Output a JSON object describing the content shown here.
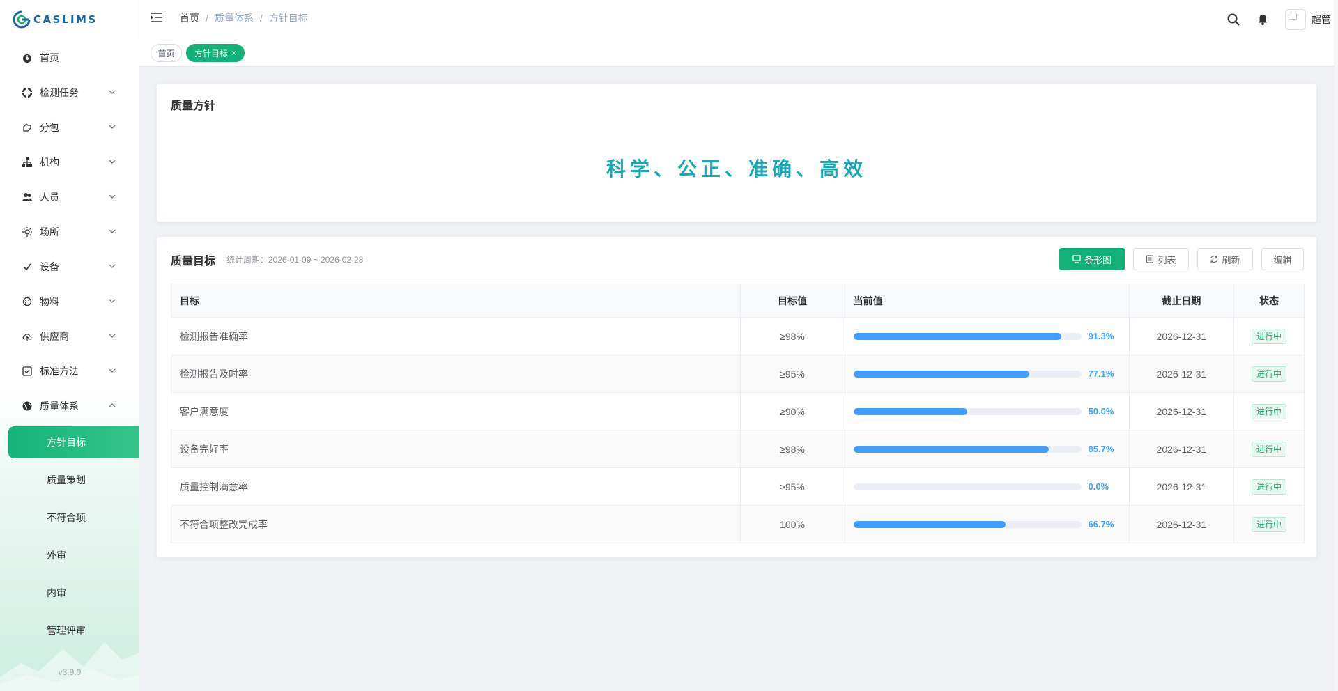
{
  "app": {
    "logo_text": "CASLIMS",
    "version": "v3.9.0"
  },
  "sidebar": {
    "items": [
      {
        "label": "首页",
        "icon": "dashboard-icon"
      },
      {
        "label": "检测任务",
        "icon": "task-icon"
      },
      {
        "label": "分包",
        "icon": "subcontract-icon"
      },
      {
        "label": "机构",
        "icon": "org-tree-icon"
      },
      {
        "label": "人员",
        "icon": "users-icon"
      },
      {
        "label": "场所",
        "icon": "sun-icon"
      },
      {
        "label": "设备",
        "icon": "check-icon"
      },
      {
        "label": "物料",
        "icon": "palette-icon"
      },
      {
        "label": "供应商",
        "icon": "cloud-upload-icon"
      },
      {
        "label": "标准方法",
        "icon": "checkbox-icon"
      },
      {
        "label": "质量体系",
        "icon": "globe-icon"
      }
    ],
    "sub_items": [
      {
        "label": "方针目标"
      },
      {
        "label": "质量策划"
      },
      {
        "label": "不符合项"
      },
      {
        "label": "外审"
      },
      {
        "label": "内审"
      },
      {
        "label": "管理评审"
      }
    ]
  },
  "header": {
    "breadcrumb": [
      "首页",
      "质量体系",
      "方针目标"
    ],
    "user_name": "超管"
  },
  "tags": {
    "home": "首页",
    "active": "方针目标",
    "close": "×"
  },
  "policy_card": {
    "title": "质量方针",
    "policy": "科学、公正、准确、高效"
  },
  "goals_card": {
    "title": "质量目标",
    "period": "统计周期：2026-01-09 ~ 2026-02-28",
    "buttons": {
      "chart": "条形图",
      "list": "列表",
      "refresh": "刷新",
      "edit": "编辑"
    },
    "columns": {
      "name": "目标",
      "target": "目标值",
      "current": "当前值",
      "deadline": "截止日期",
      "status": "状态"
    },
    "rows": [
      {
        "name": "检测报告准确率",
        "target": "≥98%",
        "progress": 91.3,
        "progress_text": "91.3%",
        "deadline": "2026-12-31",
        "status": "进行中"
      },
      {
        "name": "检测报告及时率",
        "target": "≥95%",
        "progress": 77.1,
        "progress_text": "77.1%",
        "deadline": "2026-12-31",
        "status": "进行中"
      },
      {
        "name": "客户满意度",
        "target": "≥90%",
        "progress": 50.0,
        "progress_text": "50.0%",
        "deadline": "2026-12-31",
        "status": "进行中"
      },
      {
        "name": "设备完好率",
        "target": "≥98%",
        "progress": 85.7,
        "progress_text": "85.7%",
        "deadline": "2026-12-31",
        "status": "进行中"
      },
      {
        "name": "质量控制满意率",
        "target": "≥95%",
        "progress": 0.0,
        "progress_text": "0.0%",
        "deadline": "2026-12-31",
        "status": "进行中"
      },
      {
        "name": "不符合项整改完成率",
        "target": "100%",
        "progress": 66.7,
        "progress_text": "66.7%",
        "deadline": "2026-12-31",
        "status": "进行中"
      }
    ]
  },
  "colors": {
    "primary": "#13b079",
    "progress": "#409eff",
    "policy_text": "#19a9b4",
    "logo": "#1a64a6"
  }
}
